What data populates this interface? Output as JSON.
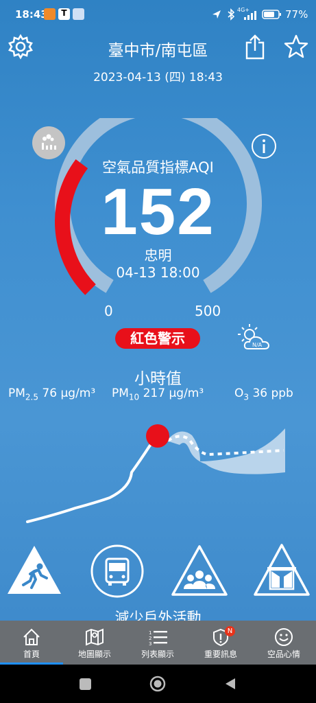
{
  "status": {
    "time": "18:43",
    "battery": "77%",
    "network": "4G+"
  },
  "header": {
    "city": "臺中市/南屯區",
    "datetime": "2023-04-13 (四) 18:43"
  },
  "aqi": {
    "title": "空氣品質指標AQI",
    "value": "152",
    "station": "忠明",
    "time": "04-13 18:00",
    "scale_min": "0",
    "scale_max": "500",
    "alert": "紅色警示",
    "level_fraction": 0.304,
    "color": "#e8101a"
  },
  "weather": {
    "icon": "partly-cloudy-icon",
    "label": "N/A"
  },
  "hourly": {
    "title": "小時值",
    "pm25": {
      "label": "PM",
      "sub": "2.5",
      "value": "76 μg/m³"
    },
    "pm10": {
      "label": "PM",
      "sub": "10",
      "value": "217 μg/m³"
    },
    "o3": {
      "label": "O",
      "sub": "3",
      "value": "36 ppb"
    }
  },
  "activities": {
    "caption": "減少戶外活動",
    "icons": [
      "running-warning-icon",
      "bus-icon",
      "group-warning-icon",
      "window-warning-icon"
    ]
  },
  "nav": {
    "items": [
      {
        "label": "首頁",
        "icon": "home-icon"
      },
      {
        "label": "地圖顯示",
        "icon": "map-icon"
      },
      {
        "label": "列表顯示",
        "icon": "list-icon"
      },
      {
        "label": "重要訊息",
        "icon": "alert-icon",
        "badge": "N"
      },
      {
        "label": "空品心情",
        "icon": "smiley-icon"
      }
    ]
  }
}
